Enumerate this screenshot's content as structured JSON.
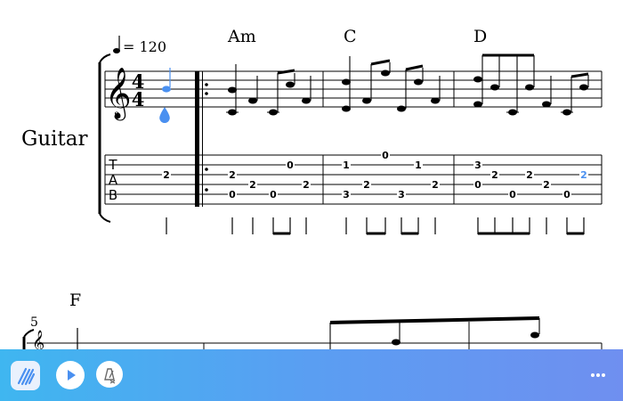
{
  "score": {
    "tempo_value": "= 120",
    "instrument": "Guitar",
    "time_signature": {
      "top": "4",
      "bottom": "4"
    },
    "clef_octave": "8",
    "tab_letters": [
      "T",
      "A",
      "B"
    ],
    "chords": [
      "Am",
      "C",
      "D",
      "F"
    ],
    "measure_number": "5",
    "tab_numbers": {
      "m0": [
        "2"
      ],
      "m1": [
        "2",
        "0",
        "2",
        "0",
        "0",
        "2"
      ],
      "m2": [
        "3",
        "1",
        "2",
        "0",
        "3",
        "1",
        "2"
      ],
      "m3": [
        "3",
        "0",
        "2",
        "2",
        "0",
        "2",
        "0",
        "0",
        "2"
      ]
    }
  },
  "colors": {
    "accent": "#4a90f0",
    "toolbar_start": "#3fb6f0",
    "toolbar_end": "#6f8ff0"
  },
  "toolbar": {
    "buttons": [
      "app-logo-icon",
      "play-icon",
      "metronome-icon",
      "more-icon"
    ]
  }
}
